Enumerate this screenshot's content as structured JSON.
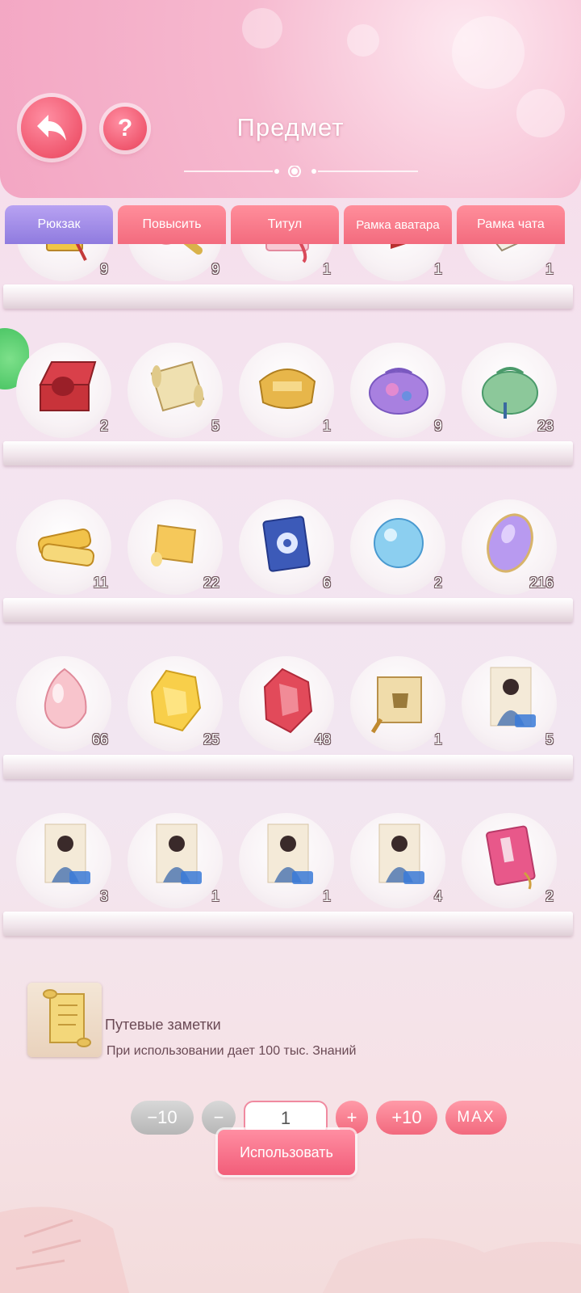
{
  "header": {
    "title": "Предмет"
  },
  "tabs": [
    {
      "label": "Рюкзак",
      "active": true
    },
    {
      "label": "Повысить",
      "active": false
    },
    {
      "label": "Титул",
      "active": false
    },
    {
      "label": "Рамка аватара",
      "active": false
    },
    {
      "label": "Рамка чата",
      "active": false
    }
  ],
  "grid": {
    "rows": [
      [
        {
          "icon": "imperial-edict-icon",
          "count": "9"
        },
        {
          "icon": "scroll-rod-icon",
          "count": "9"
        },
        {
          "icon": "pink-envelope-icon",
          "count": "1"
        },
        {
          "icon": "red-box-icon",
          "count": "1"
        },
        {
          "icon": "bamboo-slips-icon",
          "count": "1"
        }
      ],
      [
        {
          "icon": "red-jewel-box-icon",
          "count": "2"
        },
        {
          "icon": "old-scroll-icon",
          "count": "5"
        },
        {
          "icon": "gold-lock-icon",
          "count": "1"
        },
        {
          "icon": "purple-pouch-icon",
          "count": "9"
        },
        {
          "icon": "green-pouch-icon",
          "count": "23"
        }
      ],
      [
        {
          "icon": "gold-scrolls-icon",
          "count": "11"
        },
        {
          "icon": "gold-scroll-icon",
          "count": "22"
        },
        {
          "icon": "blue-book-icon",
          "count": "6"
        },
        {
          "icon": "crystal-orb-icon",
          "count": "2"
        },
        {
          "icon": "purple-gem-icon",
          "count": "216"
        }
      ],
      [
        {
          "icon": "pink-gem-icon",
          "count": "66"
        },
        {
          "icon": "gold-gem-icon",
          "count": "25"
        },
        {
          "icon": "red-gem-icon",
          "count": "48"
        },
        {
          "icon": "tripod-scroll-icon",
          "count": "1"
        },
        {
          "icon": "character-card-icon",
          "count": "5"
        }
      ],
      [
        {
          "icon": "character-card-icon",
          "count": "3"
        },
        {
          "icon": "character-card-icon",
          "count": "1"
        },
        {
          "icon": "character-card-icon",
          "count": "1"
        },
        {
          "icon": "character-card-icon",
          "count": "4"
        },
        {
          "icon": "pink-book-icon",
          "count": "2"
        }
      ]
    ]
  },
  "detail": {
    "name": "Путевые заметки",
    "description": "При использовании дает 100 тыс. Знаний"
  },
  "controls": {
    "minus10": "−10",
    "minus": "−",
    "quantity": "1",
    "plus": "+",
    "plus10": "+10",
    "max": "MAX",
    "use": "Использовать"
  },
  "colors": {
    "accent_pink": "#f2697e",
    "active_tab": "#8f7bdf",
    "disabled_gray": "#b6b6b6"
  }
}
